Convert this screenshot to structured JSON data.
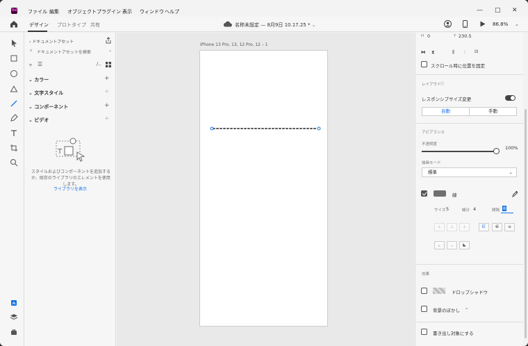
{
  "menubar": {
    "logo": "Xd",
    "items": [
      "ファイル",
      "編集",
      "オブジェクト",
      "プラグイン",
      "表示",
      "ウィンドウ",
      "ヘルプ"
    ],
    "window_controls": [
      "—",
      "□",
      "✕"
    ]
  },
  "topbar": {
    "tabs": [
      "デザイン",
      "プロトタイプ",
      "共有"
    ],
    "document_title": "名称未設定 — 8月9日 10.17.25 *",
    "zoom": "86.8%"
  },
  "tools": [
    "select-tool",
    "rectangle-tool",
    "ellipse-tool",
    "triangle-tool",
    "line-tool",
    "pen-tool",
    "text-tool",
    "artboard-tool",
    "zoom-tool"
  ],
  "assets": {
    "title": "ドキュメントアセット",
    "search_placeholder": "ドキュメントアセットを検索",
    "sections": [
      "カラー",
      "文字スタイル",
      "コンポーネント",
      "ビデオ"
    ],
    "empty_message": "スタイルおよびコンポーネントを追加するか、既存のライブラリのエレメントを使用します。",
    "show_library": "ライブラリを表示"
  },
  "canvas": {
    "artboard_label": "iPhone 13 Pro, 13, 12 Pro, 12 – 1"
  },
  "props": {
    "h_label": "H",
    "h_value": "0",
    "y_label": "Y",
    "y_value": "230.5",
    "fix_on_scroll": "スクロール時に位置を固定",
    "layout_title": "レイアウト",
    "responsive_resize": "レスポンシブサイズ変更",
    "auto_label": "自動",
    "manual_label": "手動",
    "appearance_title": "アピアランス",
    "opacity_label": "不透明度",
    "opacity_value": "100%",
    "opacity_fraction": 1.0,
    "blend_label": "描画モード",
    "blend_value": "標準",
    "stroke_label": "線",
    "stroke_color": "#707070",
    "size_label": "サイズ",
    "size_value": "5",
    "dash_label": "線分",
    "dash_value": "4",
    "gap_label": "間隔",
    "gap_value": "8",
    "effects_title": "効果",
    "drop_shadow": "ドロップシャドウ",
    "bg_blur": "背景のぼかし",
    "mark_export": "書き出し対象にする"
  }
}
